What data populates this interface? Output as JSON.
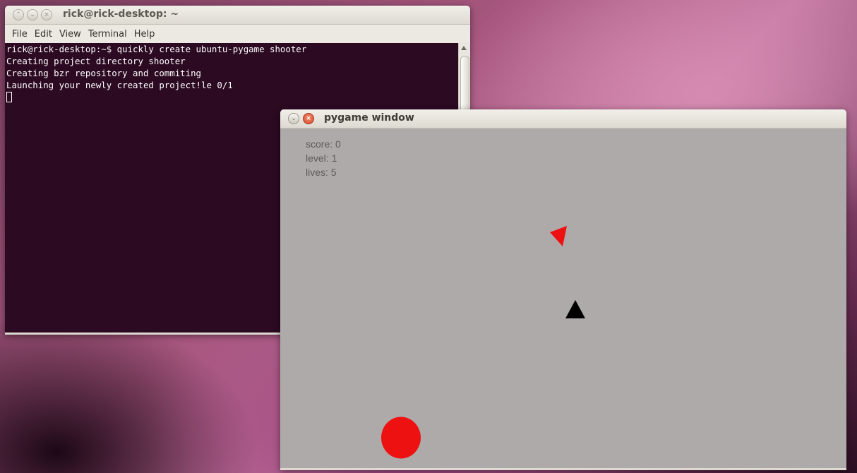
{
  "terminal": {
    "title": "rick@rick-desktop: ~",
    "menu": [
      "File",
      "Edit",
      "View",
      "Terminal",
      "Help"
    ],
    "lines": [
      "rick@rick-desktop:~$ quickly create ubuntu-pygame shooter",
      "Creating project directory shooter",
      "Creating bzr repository and commiting",
      "Launching your newly created project!le 0/1"
    ]
  },
  "pygame": {
    "title": "pygame window",
    "hud": {
      "score": "score: 0",
      "level": "level: 1",
      "lives": "lives: 5"
    }
  },
  "icons": {
    "minimize": "chevron-down-icon",
    "maximize": "chevron-up-icon",
    "close": "close-icon"
  },
  "colors": {
    "terminal_bg": "#2c0a22",
    "game_bg": "#aeaaa9",
    "enemy": "#ee1111",
    "player": "#000000",
    "hud_text": "#5d5a5a"
  }
}
